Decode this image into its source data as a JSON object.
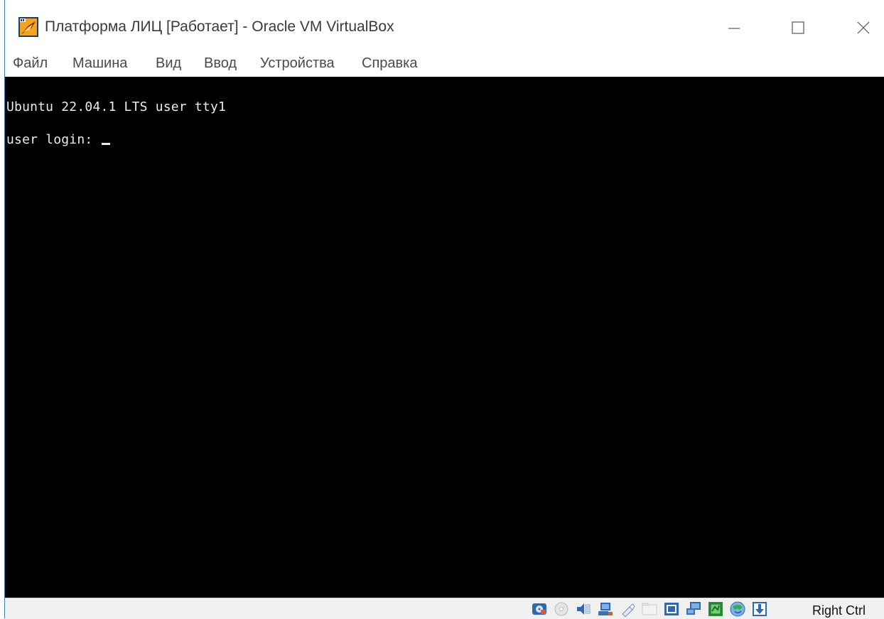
{
  "window": {
    "title": "Платформа ЛИЦ [Работает] - Oracle VM VirtualBox",
    "app_icon": "virtualbox-icon",
    "controls": [
      "minimize-icon",
      "maximize-icon",
      "close-icon"
    ]
  },
  "menu": {
    "items": [
      {
        "label": "Файл"
      },
      {
        "label": "Машина"
      },
      {
        "label": "Вид"
      },
      {
        "label": "Ввод"
      },
      {
        "label": "Устройства"
      },
      {
        "label": "Справка"
      }
    ]
  },
  "console": {
    "lines": [
      "Ubuntu 22.04.1 LTS user tty1",
      "user login: "
    ]
  },
  "statusbar": {
    "icons": [
      "hard-disk-icon",
      "optical-drive-icon",
      "audio-icon",
      "network-icon",
      "usb-icon",
      "shared-folders-icon",
      "display-icon",
      "video-capture-icon",
      "cpu-icon",
      "mouse-integration-icon",
      "keyboard-capture-icon"
    ],
    "host_key": "Right Ctrl"
  },
  "colors": {
    "accent": "#3c7fb1",
    "console_bg": "#000000",
    "console_fg": "#ececec"
  }
}
